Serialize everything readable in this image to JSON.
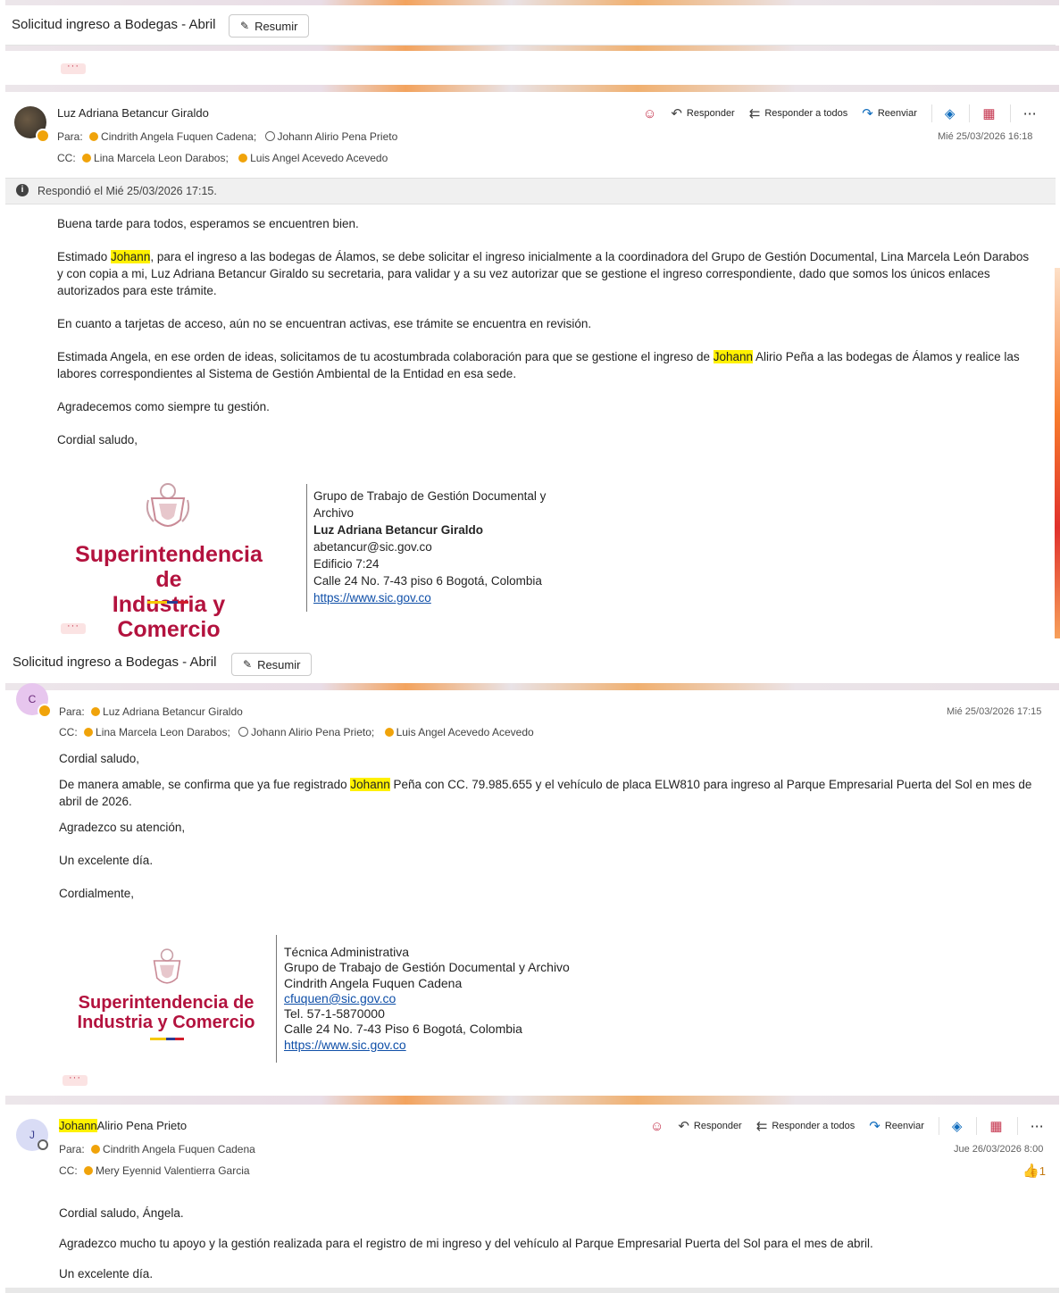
{
  "subject": "Solicitud ingreso a Bodegas - Abril",
  "resumir_label": "Resumir",
  "dots": "···",
  "msg1": {
    "sender": "Luz Adriana Betancur Giraldo",
    "to_label": "Para:",
    "to1": "Cindrith Angela Fuquen Cadena;",
    "to2": "Johann Alirio Pena Prieto",
    "cc_label": "CC:",
    "cc1": "Lina Marcela Leon Darabos;",
    "cc2": "Luis Angel Acevedo Acevedo",
    "date": "Mié 25/03/2026 16:18",
    "reply": "Responder",
    "reply_all": "Responder a todos",
    "forward": "Reenviar",
    "replied_info": "Respondió el Mié 25/03/2026 17:15.",
    "greeting": "Buena tarde para todos, esperamos se encuentren bien.",
    "p1_a": "Estimado ",
    "p1_hl": "Johann",
    "p1_b": ", para el ingreso a las bodegas de Álamos, se debe solicitar el ingreso inicialmente a la coordinadora del Grupo de Gestión Documental, Lina Marcela León Darabos y con copia a mi, Luz Adriana Betancur Giraldo su secretaria,  para validar y a su vez autorizar que se gestione el ingreso correspondiente, dado que somos los únicos enlaces autorizados para este trámite.",
    "p2": "En cuanto a tarjetas de acceso, aún no se encuentran activas, ese trámite se encuentra en revisión.",
    "p3_a": "Estimada Angela, en ese orden de ideas, solicitamos de tu acostumbrada colaboración para que se gestione el ingreso de ",
    "p3_hl": "Johann",
    "p3_b": " Alirio Peña a las bodegas de Álamos y realice las labores correspondientes al Sistema de Gestión Ambiental de la Entidad en esa sede.",
    "p4": "Agradecemos como siempre tu gestión.",
    "p5": "Cordial saludo,",
    "logo_line1": "Superintendencia de",
    "logo_line2": "Industria y Comercio",
    "sig1": "Grupo de Trabajo de Gestión Documental y",
    "sig2": "Archivo",
    "sig3": "Luz Adriana Betancur Giraldo",
    "sig4": "abetancur@sic.gov.co",
    "sig5": "Edificio 7:24",
    "sig6": "Calle 24 No. 7-43 piso 6 Bogotá, Colombia",
    "sig7": "https://www.sic.gov.co"
  },
  "msg2": {
    "avatar_initial": "C",
    "to_label": "Para:",
    "to1": "Luz Adriana Betancur Giraldo",
    "cc_label": "CC:",
    "cc1": "Lina Marcela Leon Darabos;",
    "cc2": "Johann Alirio Pena Prieto;",
    "cc3": "Luis Angel Acevedo Acevedo",
    "date": "Mié 25/03/2026 17:15",
    "p1": "Cordial saludo,",
    "p2_a": "De manera amable, se confirma que ya fue registrado ",
    "p2_hl": "Johann",
    "p2_b": " Peña con CC. 79.985.655 y el vehículo de placa ELW810 para ingreso al Parque Empresarial Puerta del Sol en mes de abril de 2026.",
    "p3": "Agradezco su atención,",
    "p4": "Un excelente día.",
    "p5": "Cordialmente,",
    "logo_line1": "Superintendencia de",
    "logo_line2": "Industria y Comercio",
    "sig1": "Técnica Administrativa",
    "sig2": "Grupo de Trabajo de Gestión Documental y Archivo",
    "sig3": "Cindrith Angela Fuquen Cadena",
    "sig4": "cfuquen@sic.gov.co",
    "sig5": "Tel. 57-1-5870000",
    "sig6": "Calle 24 No. 7-43 Piso 6 Bogotá, Colombia",
    "sig7": "https://www.sic.gov.co"
  },
  "msg3": {
    "avatar_initial": "J",
    "sender_hl": "Johann",
    "sender_rest": "Alirio Pena Prieto",
    "to_label": "Para:",
    "to1": "Cindrith Angela Fuquen Cadena",
    "cc_label": "CC:",
    "cc1": "Mery Eyennid Valentierra Garcia",
    "date": "Jue 26/03/2026 8:00",
    "reply": "Responder",
    "reply_all": "Responder a todos",
    "forward": "Reenviar",
    "reaction_count": "1",
    "p1": "Cordial saludo, Ángela.",
    "p2": "Agradezco mucho tu apoyo y la gestión realizada para el registro de mi ingreso y del vehículo al Parque Empresarial Puerta del Sol para el mes de abril.",
    "p3": "Un excelente día."
  }
}
